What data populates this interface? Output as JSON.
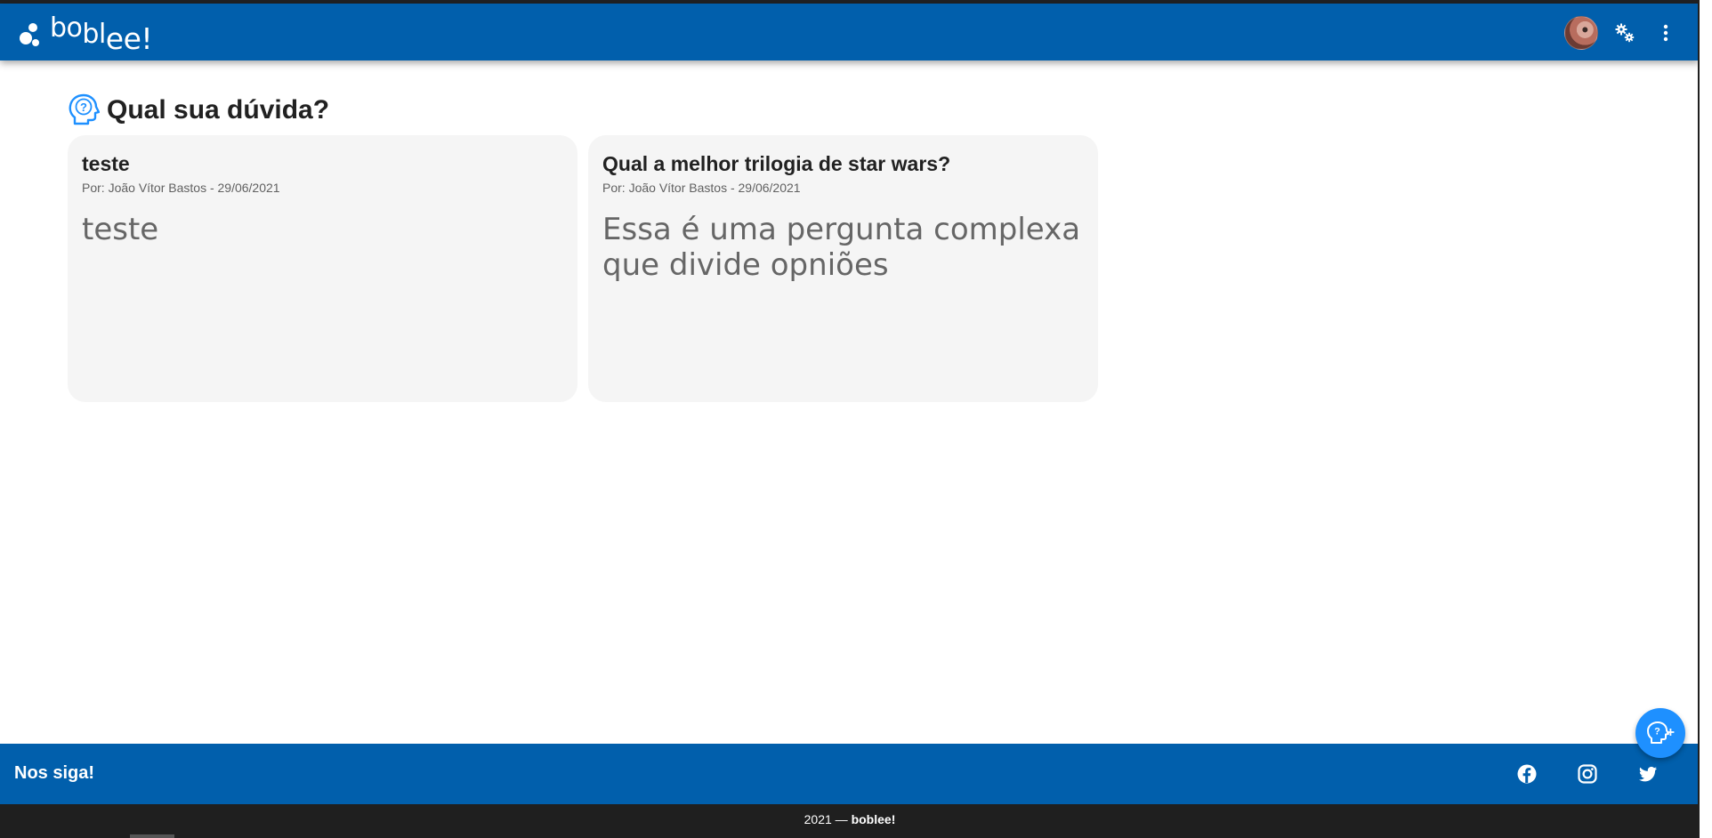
{
  "app": {
    "logo_text": [
      "bo",
      "bl",
      "ee!"
    ],
    "brand_color": "#015fac",
    "accent_color": "#1e90ff"
  },
  "toolbar": {
    "avatar": "avatar",
    "settings_icon": "cogs-icon",
    "menu_icon": "more-vert-icon"
  },
  "page": {
    "title": "Qual sua dúvida?",
    "title_icon": "question-head-icon"
  },
  "questions": [
    {
      "title": "teste",
      "meta": "Por: João Vítor Bastos - 29/06/2021",
      "body": "teste"
    },
    {
      "title": "Qual a melhor trilogia de star wars?",
      "meta": "Por: João Vítor Bastos - 29/06/2021",
      "body": "Essa é uma pergunta complexa que divide opniões"
    }
  ],
  "fab": {
    "icon": "add-question-icon"
  },
  "footer": {
    "follow_label": "Nos siga!",
    "socials": [
      "facebook-icon",
      "instagram-icon",
      "twitter-icon"
    ],
    "copyright_prefix": "2021 — ",
    "copyright_brand": "boblee!"
  }
}
